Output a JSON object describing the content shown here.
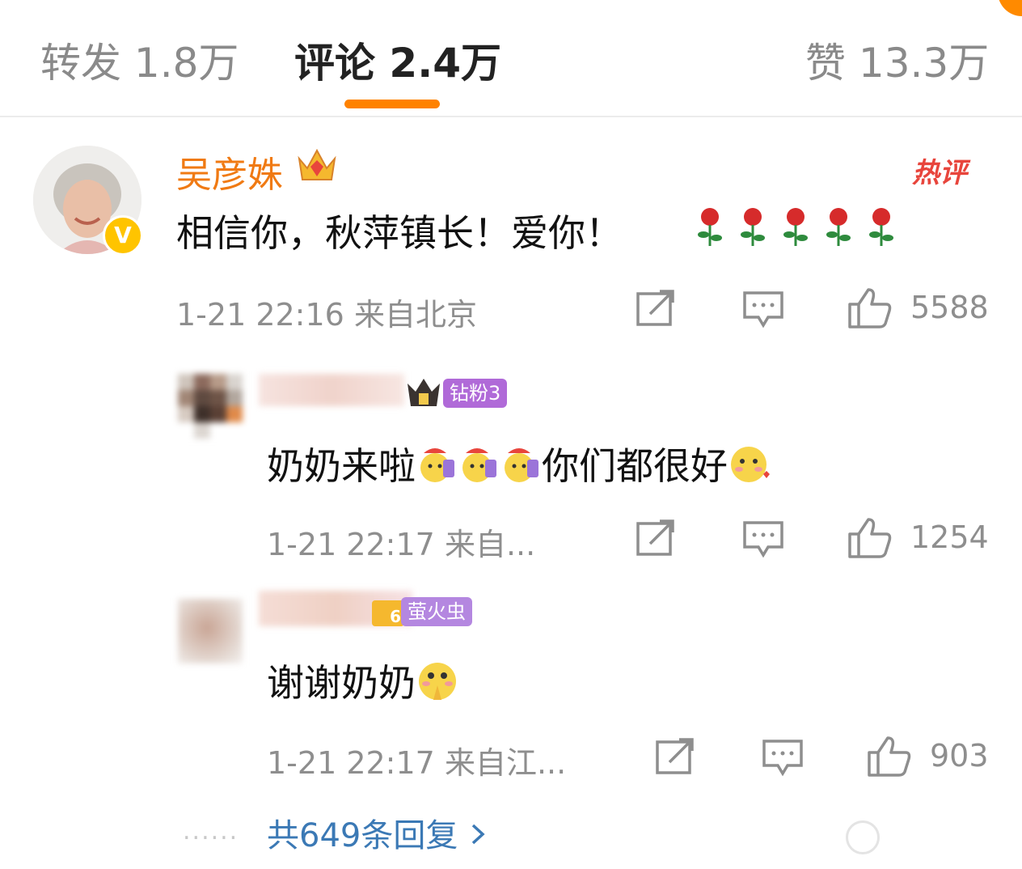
{
  "tabs": [
    {
      "label": "转发 1.8万"
    },
    {
      "label": "评论 2.4万"
    },
    {
      "label": "赞 13.3万"
    }
  ],
  "colors": {
    "accent": "#ff8200",
    "name": "#f07a13",
    "link": "#3b79b5",
    "hot": "#e8453c"
  },
  "main_comment": {
    "user": "吴彦姝",
    "hot_badge": "热评",
    "text": "相信你，秋萍镇长！爱你！",
    "emojis": [
      "rose",
      "rose",
      "rose",
      "rose",
      "rose"
    ],
    "time": "1-21 22:16",
    "location": "来自北京",
    "likes": "5588"
  },
  "replies": [
    {
      "badge": "钻粉3",
      "text": "奶奶来啦",
      "emoji_mid": [
        "好运+1",
        "好运+1",
        "好运+1"
      ],
      "text2": "你们都很好",
      "time": "1-21 22:17",
      "location": "来自...",
      "likes": "1254"
    },
    {
      "badge": "萤火虫",
      "badge_level": "6",
      "text": "谢谢奶奶",
      "time": "1-21 22:17",
      "location": "来自江...",
      "likes": "903"
    }
  ],
  "more_replies": "共649条回复",
  "dots": "......",
  "icons": [
    "share-icon",
    "comment-icon",
    "like-icon",
    "chevron-right-icon"
  ]
}
